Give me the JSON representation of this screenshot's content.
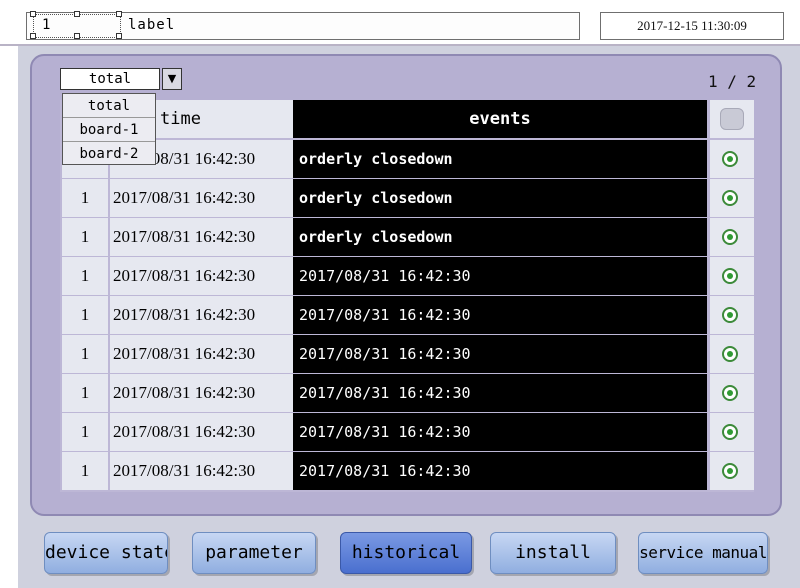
{
  "header": {
    "id_value": "1",
    "label": "label",
    "datetime": "2017-12-15 11:30:09"
  },
  "filter": {
    "selected": "total",
    "options": [
      "total",
      "board-1",
      "board-2"
    ]
  },
  "pagination": {
    "text": "1 / 2"
  },
  "table": {
    "columns": {
      "time": "time",
      "events": "events"
    },
    "rows": [
      {
        "no": "",
        "time": "2017/08/31 16:42:30",
        "event": "orderly closedown",
        "status": "ok"
      },
      {
        "no": "1",
        "time": "2017/08/31 16:42:30",
        "event": "orderly closedown",
        "status": "ok"
      },
      {
        "no": "1",
        "time": "2017/08/31 16:42:30",
        "event": "orderly closedown",
        "status": "ok"
      },
      {
        "no": "1",
        "time": "2017/08/31 16:42:30",
        "event": "2017/08/31  16:42:30",
        "status": "ok"
      },
      {
        "no": "1",
        "time": "2017/08/31 16:42:30",
        "event": "2017/08/31  16:42:30",
        "status": "ok"
      },
      {
        "no": "1",
        "time": "2017/08/31 16:42:30",
        "event": "2017/08/31  16:42:30",
        "status": "ok"
      },
      {
        "no": "1",
        "time": "2017/08/31 16:42:30",
        "event": "2017/08/31  16:42:30",
        "status": "ok"
      },
      {
        "no": "1",
        "time": "2017/08/31 16:42:30",
        "event": "2017/08/31  16:42:30",
        "status": "ok"
      },
      {
        "no": "1",
        "time": "2017/08/31 16:42:30",
        "event": "2017/08/31  16:42:30",
        "status": "ok"
      }
    ]
  },
  "nav": {
    "device_state": "device state",
    "parameter": "parameter",
    "historical": "historical",
    "install": "install",
    "service_manual": "service manual",
    "active": "historical"
  },
  "icons": {
    "status": "status-led-icon",
    "dropdown": "chevron-down-icon"
  },
  "colors": {
    "accent": "#4a6fcf",
    "panel": "#b6b0d2",
    "status_ok": "#2f9a33"
  }
}
